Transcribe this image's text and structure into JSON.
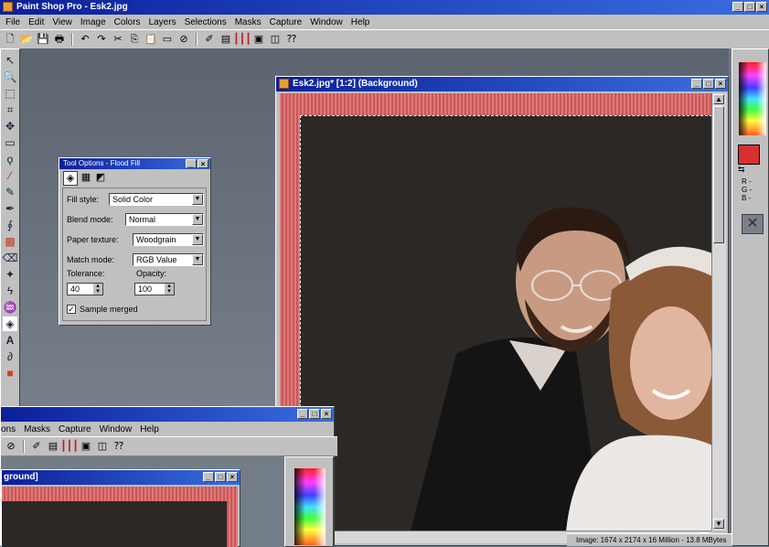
{
  "app": {
    "title": "Paint Shop Pro - Esk2.jpg",
    "menu": [
      "File",
      "Edit",
      "View",
      "Image",
      "Colors",
      "Layers",
      "Selections",
      "Masks",
      "Capture",
      "Window",
      "Help"
    ]
  },
  "toolbar_icons": [
    "new-icon",
    "open-icon",
    "save-icon",
    "print-icon",
    "undo-icon",
    "redo-icon",
    "cut-icon",
    "copy-icon",
    "paste-icon",
    "view-icon",
    "stop-icon",
    "brush-icon",
    "layers-icon",
    "bars-icon",
    "image-icon",
    "palette-icon",
    "help-icon"
  ],
  "tool_options": {
    "title": "Tool Options - Flood Fill",
    "fill_style_label": "Fill style:",
    "fill_style_value": "Solid Color",
    "blend_mode_label": "Blend mode:",
    "blend_mode_value": "Normal",
    "paper_texture_label": "Paper texture:",
    "paper_texture_value": "Woodgrain",
    "match_mode_label": "Match mode:",
    "match_mode_value": "RGB Value",
    "tolerance_label": "Tolerance:",
    "tolerance_value": "40",
    "opacity_label": "Opacity:",
    "opacity_value": "100",
    "sample_merged_label": "Sample merged",
    "sample_merged_checked": true
  },
  "image_window": {
    "title": "Esk2.jpg* [1:2] (Background)"
  },
  "status_bar": {
    "text": "Image:  1674 x 2174 x 16 Million - 13.8 MBytes"
  },
  "color_panel": {
    "fg_color": "#d83030",
    "rgb_labels": [
      "R -",
      "G -",
      "B -"
    ]
  },
  "second_window": {
    "menu": [
      "ons",
      "Masks",
      "Capture",
      "Window",
      "Help"
    ],
    "image_title": "ground]"
  }
}
